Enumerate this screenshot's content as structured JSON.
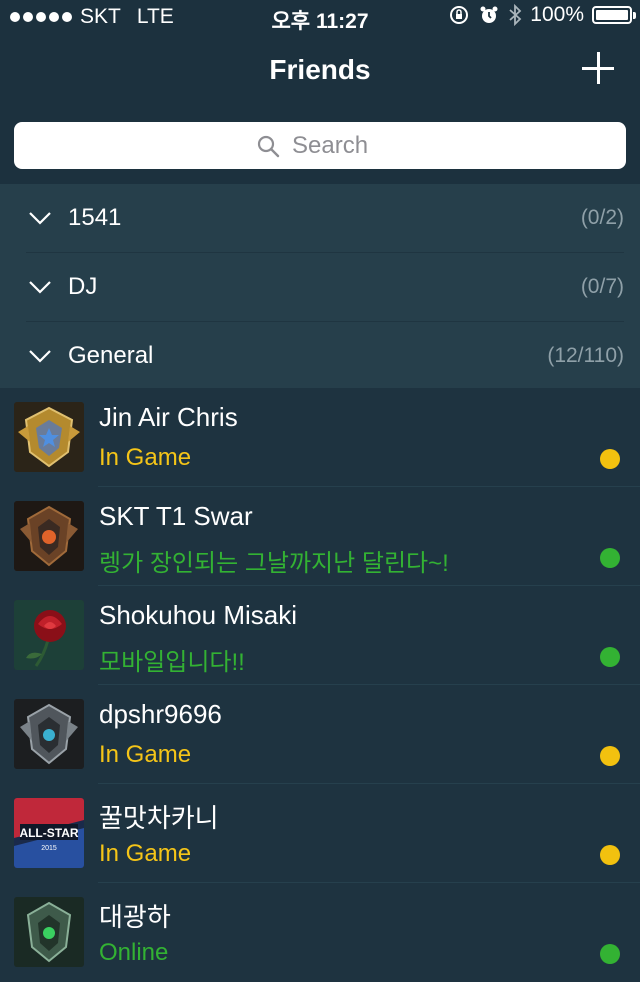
{
  "status_bar": {
    "carrier": "SKT",
    "network": "LTE",
    "time": "오후 11:27",
    "battery": "100%"
  },
  "nav": {
    "title": "Friends",
    "add_icon": "plus-icon"
  },
  "search": {
    "placeholder": "Search",
    "icon": "search-icon"
  },
  "groups": [
    {
      "name": "1541",
      "count": "(0/2)"
    },
    {
      "name": "DJ",
      "count": "(0/7)"
    },
    {
      "name": "General",
      "count": "(12/110)"
    }
  ],
  "friends": [
    {
      "name": "Jin Air Chris",
      "status": "In Game",
      "status_color": "#f5c518",
      "dot_color": "#f2c10f",
      "avatar": "gold-crest"
    },
    {
      "name": "SKT T1 Swar",
      "status": "렝가 장인되는 그날까지난 달린다~!",
      "status_color": "#33b233",
      "dot_color": "#33b233",
      "avatar": "bronze-crest"
    },
    {
      "name": "Shokuhou Misaki",
      "status": "모바일입니다!!",
      "status_color": "#33b233",
      "dot_color": "#33b233",
      "avatar": "red-rose"
    },
    {
      "name": "dpshr9696",
      "status": "In Game",
      "status_color": "#f5c518",
      "dot_color": "#f2c10f",
      "avatar": "silver-crest"
    },
    {
      "name": "꿀맛차카니",
      "status": "In Game",
      "status_color": "#f5c518",
      "dot_color": "#f2c10f",
      "avatar": "all-star-2015"
    },
    {
      "name": "대광하",
      "status": "Online",
      "status_color": "#33b233",
      "dot_color": "#33b233",
      "avatar": "green-crest"
    }
  ]
}
